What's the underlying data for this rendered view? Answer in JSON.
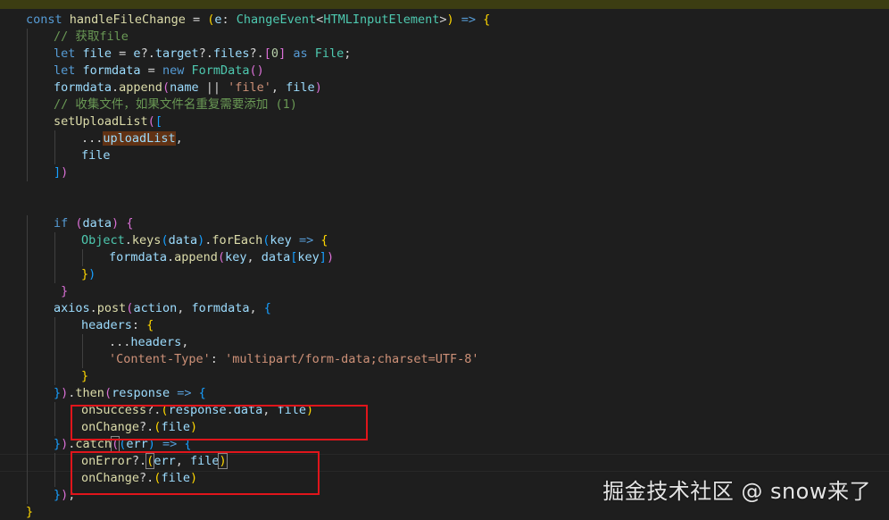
{
  "editor": {
    "lines": [
      {
        "indent": 0,
        "tokens": [
          {
            "t": "const ",
            "c": "kw"
          },
          {
            "t": "handleFileChange",
            "c": "fn"
          },
          {
            "t": " = ",
            "c": "pun"
          },
          {
            "t": "(",
            "c": "br1"
          },
          {
            "t": "e",
            "c": "var"
          },
          {
            "t": ": ",
            "c": "pun"
          },
          {
            "t": "ChangeEvent",
            "c": "typ"
          },
          {
            "t": "<",
            "c": "pun"
          },
          {
            "t": "HTMLInputElement",
            "c": "typ"
          },
          {
            "t": ">",
            "c": "pun"
          },
          {
            "t": ")",
            "c": "br1"
          },
          {
            "t": " => ",
            "c": "kw"
          },
          {
            "t": "{",
            "c": "br1"
          }
        ]
      },
      {
        "indent": 1,
        "tokens": [
          {
            "t": "// 获取file",
            "c": "cmt"
          }
        ]
      },
      {
        "indent": 1,
        "tokens": [
          {
            "t": "let ",
            "c": "kw"
          },
          {
            "t": "file",
            "c": "var"
          },
          {
            "t": " = ",
            "c": "pun"
          },
          {
            "t": "e",
            "c": "var"
          },
          {
            "t": "?.",
            "c": "pun"
          },
          {
            "t": "target",
            "c": "var"
          },
          {
            "t": "?.",
            "c": "pun"
          },
          {
            "t": "files",
            "c": "var"
          },
          {
            "t": "?.",
            "c": "pun"
          },
          {
            "t": "[",
            "c": "br2"
          },
          {
            "t": "0",
            "c": "num"
          },
          {
            "t": "]",
            "c": "br2"
          },
          {
            "t": " as ",
            "c": "kw"
          },
          {
            "t": "File",
            "c": "typ"
          },
          {
            "t": ";",
            "c": "pun"
          }
        ]
      },
      {
        "indent": 1,
        "tokens": [
          {
            "t": "let ",
            "c": "kw"
          },
          {
            "t": "formdata",
            "c": "var"
          },
          {
            "t": " = ",
            "c": "pun"
          },
          {
            "t": "new ",
            "c": "kw"
          },
          {
            "t": "FormData",
            "c": "typ"
          },
          {
            "t": "()",
            "c": "br2"
          }
        ]
      },
      {
        "indent": 1,
        "tokens": [
          {
            "t": "formdata",
            "c": "var"
          },
          {
            "t": ".",
            "c": "pun"
          },
          {
            "t": "append",
            "c": "fn"
          },
          {
            "t": "(",
            "c": "br2"
          },
          {
            "t": "name",
            "c": "var"
          },
          {
            "t": " || ",
            "c": "pun"
          },
          {
            "t": "'file'",
            "c": "str"
          },
          {
            "t": ", ",
            "c": "pun"
          },
          {
            "t": "file",
            "c": "var"
          },
          {
            "t": ")",
            "c": "br2"
          }
        ]
      },
      {
        "indent": 1,
        "tokens": [
          {
            "t": "// 收集文件，如果文件名重复需要添加 (1)",
            "c": "cmt"
          }
        ]
      },
      {
        "indent": 1,
        "tokens": [
          {
            "t": "setUploadList",
            "c": "fn"
          },
          {
            "t": "(",
            "c": "br2"
          },
          {
            "t": "[",
            "c": "br3"
          }
        ]
      },
      {
        "indent": 2,
        "tokens": [
          {
            "t": "...",
            "c": "pun"
          },
          {
            "t": "uploadList",
            "c": "var hl"
          },
          {
            "t": ",",
            "c": "pun"
          }
        ]
      },
      {
        "indent": 2,
        "tokens": [
          {
            "t": "file",
            "c": "var"
          }
        ]
      },
      {
        "indent": 1,
        "tokens": [
          {
            "t": "]",
            "c": "br3"
          },
          {
            "t": ")",
            "c": "br2"
          }
        ]
      },
      {
        "indent": 0,
        "tokens": []
      },
      {
        "indent": 0,
        "tokens": []
      },
      {
        "indent": 1,
        "tokens": [
          {
            "t": "if ",
            "c": "kw"
          },
          {
            "t": "(",
            "c": "br2"
          },
          {
            "t": "data",
            "c": "var"
          },
          {
            "t": ")",
            "c": "br2"
          },
          {
            "t": " ",
            "c": "pun"
          },
          {
            "t": "{",
            "c": "br2"
          }
        ]
      },
      {
        "indent": 2,
        "tokens": [
          {
            "t": "Object",
            "c": "typ"
          },
          {
            "t": ".",
            "c": "pun"
          },
          {
            "t": "keys",
            "c": "fn"
          },
          {
            "t": "(",
            "c": "br3"
          },
          {
            "t": "data",
            "c": "var"
          },
          {
            "t": ")",
            "c": "br3"
          },
          {
            "t": ".",
            "c": "pun"
          },
          {
            "t": "forEach",
            "c": "fn"
          },
          {
            "t": "(",
            "c": "br3"
          },
          {
            "t": "key",
            "c": "var"
          },
          {
            "t": " => ",
            "c": "kw"
          },
          {
            "t": "{",
            "c": "br1"
          }
        ]
      },
      {
        "indent": 3,
        "tokens": [
          {
            "t": "formdata",
            "c": "var"
          },
          {
            "t": ".",
            "c": "pun"
          },
          {
            "t": "append",
            "c": "fn"
          },
          {
            "t": "(",
            "c": "br2"
          },
          {
            "t": "key",
            "c": "var"
          },
          {
            "t": ", ",
            "c": "pun"
          },
          {
            "t": "data",
            "c": "var"
          },
          {
            "t": "[",
            "c": "br3"
          },
          {
            "t": "key",
            "c": "var"
          },
          {
            "t": "]",
            "c": "br3"
          },
          {
            "t": ")",
            "c": "br2"
          }
        ]
      },
      {
        "indent": 2,
        "tokens": [
          {
            "t": "}",
            "c": "br1"
          },
          {
            "t": ")",
            "c": "br3"
          }
        ]
      },
      {
        "indent": 1,
        "tokens": [
          {
            "t": " }",
            "c": "br2"
          }
        ]
      },
      {
        "indent": 1,
        "tokens": [
          {
            "t": "axios",
            "c": "var"
          },
          {
            "t": ".",
            "c": "pun"
          },
          {
            "t": "post",
            "c": "fn"
          },
          {
            "t": "(",
            "c": "br2"
          },
          {
            "t": "action",
            "c": "var"
          },
          {
            "t": ", ",
            "c": "pun"
          },
          {
            "t": "formdata",
            "c": "var"
          },
          {
            "t": ", ",
            "c": "pun"
          },
          {
            "t": "{",
            "c": "br3"
          }
        ]
      },
      {
        "indent": 2,
        "tokens": [
          {
            "t": "headers",
            "c": "var"
          },
          {
            "t": ": ",
            "c": "pun"
          },
          {
            "t": "{",
            "c": "br1"
          }
        ]
      },
      {
        "indent": 3,
        "tokens": [
          {
            "t": "...",
            "c": "pun"
          },
          {
            "t": "headers",
            "c": "var"
          },
          {
            "t": ",",
            "c": "pun"
          }
        ]
      },
      {
        "indent": 3,
        "tokens": [
          {
            "t": "'Content-Type'",
            "c": "str"
          },
          {
            "t": ": ",
            "c": "pun"
          },
          {
            "t": "'multipart/form-data;charset=UTF-8'",
            "c": "str"
          }
        ]
      },
      {
        "indent": 2,
        "tokens": [
          {
            "t": "}",
            "c": "br1"
          }
        ]
      },
      {
        "indent": 1,
        "tokens": [
          {
            "t": "}",
            "c": "br3"
          },
          {
            "t": ")",
            "c": "br2"
          },
          {
            "t": ".",
            "c": "pun"
          },
          {
            "t": "then",
            "c": "fn"
          },
          {
            "t": "(",
            "c": "br2"
          },
          {
            "t": "response",
            "c": "var"
          },
          {
            "t": " => ",
            "c": "kw"
          },
          {
            "t": "{",
            "c": "br3"
          }
        ]
      },
      {
        "indent": 2,
        "tokens": [
          {
            "t": "onSuccess",
            "c": "fn"
          },
          {
            "t": "?.",
            "c": "pun"
          },
          {
            "t": "(",
            "c": "br1"
          },
          {
            "t": "response",
            "c": "var"
          },
          {
            "t": ".",
            "c": "pun"
          },
          {
            "t": "data",
            "c": "var"
          },
          {
            "t": ", ",
            "c": "pun"
          },
          {
            "t": "file",
            "c": "var"
          },
          {
            "t": ")",
            "c": "br1"
          }
        ]
      },
      {
        "indent": 2,
        "tokens": [
          {
            "t": "onChange",
            "c": "fn"
          },
          {
            "t": "?.",
            "c": "pun"
          },
          {
            "t": "(",
            "c": "br1"
          },
          {
            "t": "file",
            "c": "var"
          },
          {
            "t": ")",
            "c": "br1"
          }
        ]
      },
      {
        "indent": 1,
        "tokens": [
          {
            "t": "}",
            "c": "br3"
          },
          {
            "t": ")",
            "c": "br2"
          },
          {
            "t": ".",
            "c": "pun"
          },
          {
            "t": "catch",
            "c": "fn"
          },
          {
            "t": "(",
            "c": "br2 cursor-box"
          },
          {
            "t": "(",
            "c": "br3"
          },
          {
            "t": "err",
            "c": "var"
          },
          {
            "t": ")",
            "c": "br3"
          },
          {
            "t": " => ",
            "c": "kw"
          },
          {
            "t": "{",
            "c": "br3"
          }
        ]
      },
      {
        "indent": 2,
        "tokens": [
          {
            "t": "onError",
            "c": "fn"
          },
          {
            "t": "?.",
            "c": "pun"
          },
          {
            "t": "(",
            "c": "br1 cursor-box"
          },
          {
            "t": "err",
            "c": "var"
          },
          {
            "t": ", ",
            "c": "pun"
          },
          {
            "t": "file",
            "c": "var"
          },
          {
            "t": ")",
            "c": "br1 cursor-box"
          }
        ]
      },
      {
        "indent": 2,
        "tokens": [
          {
            "t": "onChange",
            "c": "fn"
          },
          {
            "t": "?.",
            "c": "pun"
          },
          {
            "t": "(",
            "c": "br1"
          },
          {
            "t": "file",
            "c": "var"
          },
          {
            "t": ")",
            "c": "br1"
          }
        ]
      },
      {
        "indent": 1,
        "tokens": [
          {
            "t": "}",
            "c": "br3"
          },
          {
            "t": ")",
            "c": "br2"
          },
          {
            "t": ";",
            "c": "pun"
          }
        ]
      },
      {
        "indent": 0,
        "tokens": [
          {
            "t": "}",
            "c": "br1"
          }
        ]
      }
    ]
  },
  "colors": {
    "background": "#1e1e1e",
    "annotation_box": "#e0151b",
    "keyword": "#569cd6",
    "function": "#dcdcaa",
    "variable": "#9cdcfe",
    "type": "#4ec9b0",
    "string": "#ce9178",
    "comment": "#6a9955"
  },
  "watermark": {
    "text": "掘金技术社区 @ snow来了"
  }
}
